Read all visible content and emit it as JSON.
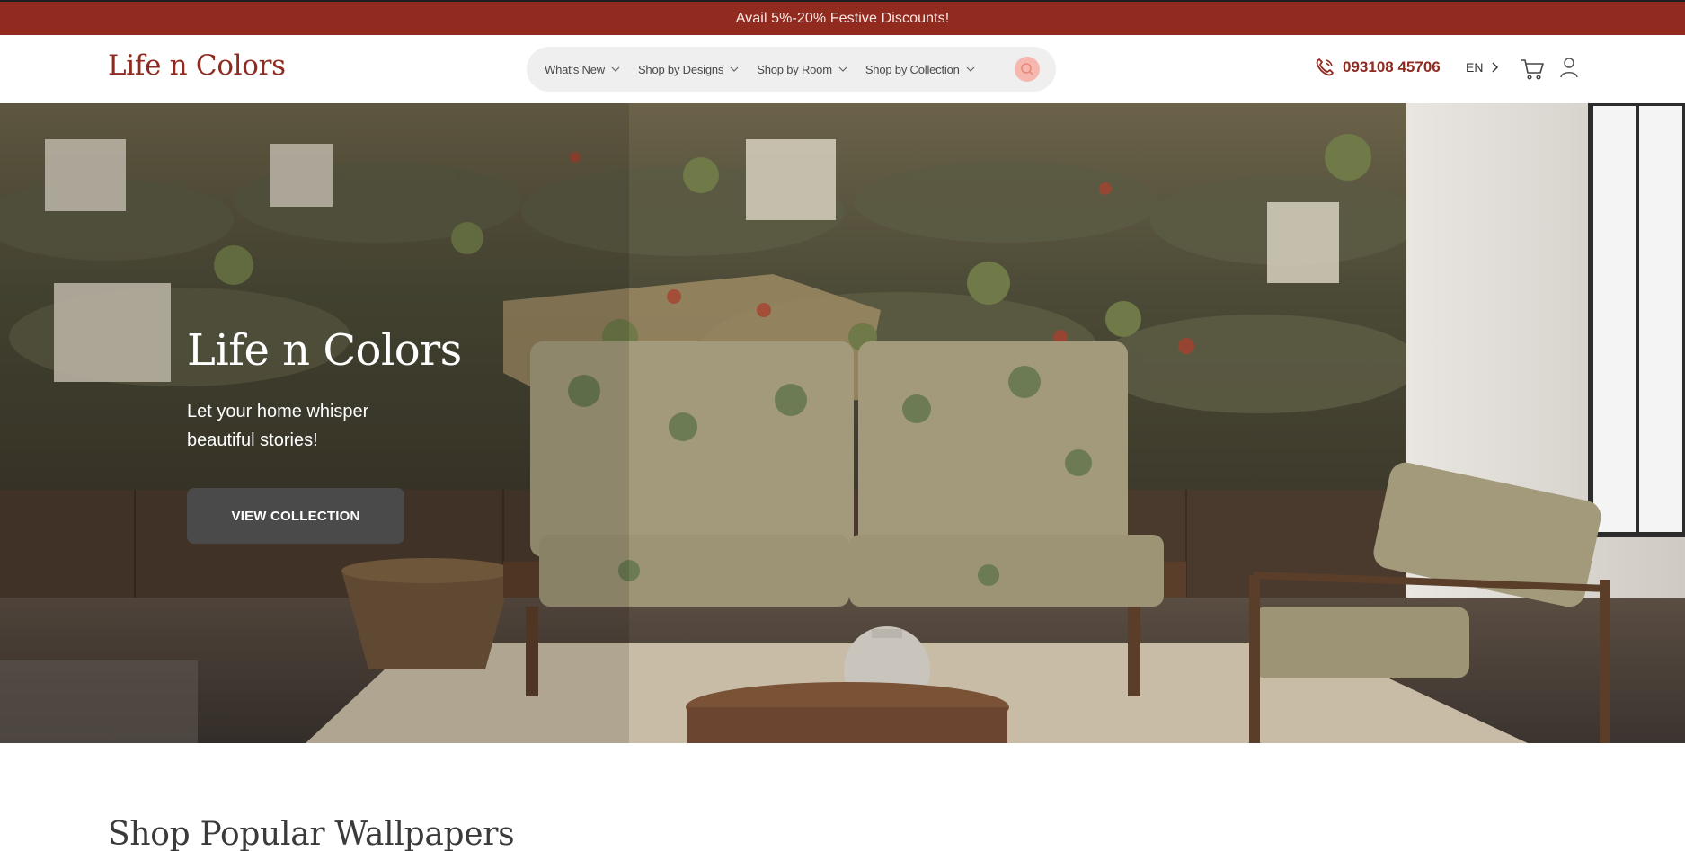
{
  "announcement": {
    "text": "Avail 5%-20% Festive Discounts!"
  },
  "header": {
    "logo": "Life n Colors",
    "nav": [
      {
        "label": "What's New"
      },
      {
        "label": "Shop by Designs"
      },
      {
        "label": "Shop by Room"
      },
      {
        "label": "Shop by Collection"
      }
    ],
    "phone": "093108 45706",
    "language": "EN"
  },
  "hero": {
    "title": "Life n Colors",
    "subtitle": "Let your home whisper beautiful stories!",
    "cta": "VIEW COLLECTION"
  },
  "section": {
    "title": "Shop Popular Wallpapers"
  },
  "colors": {
    "brand": "#912a1f",
    "search_accent": "#f6b7ae",
    "button_dark": "#4a4a4a"
  },
  "icons": [
    "chevron-down-icon",
    "search-icon",
    "phone-icon",
    "chevron-right-icon",
    "cart-icon",
    "user-icon"
  ]
}
